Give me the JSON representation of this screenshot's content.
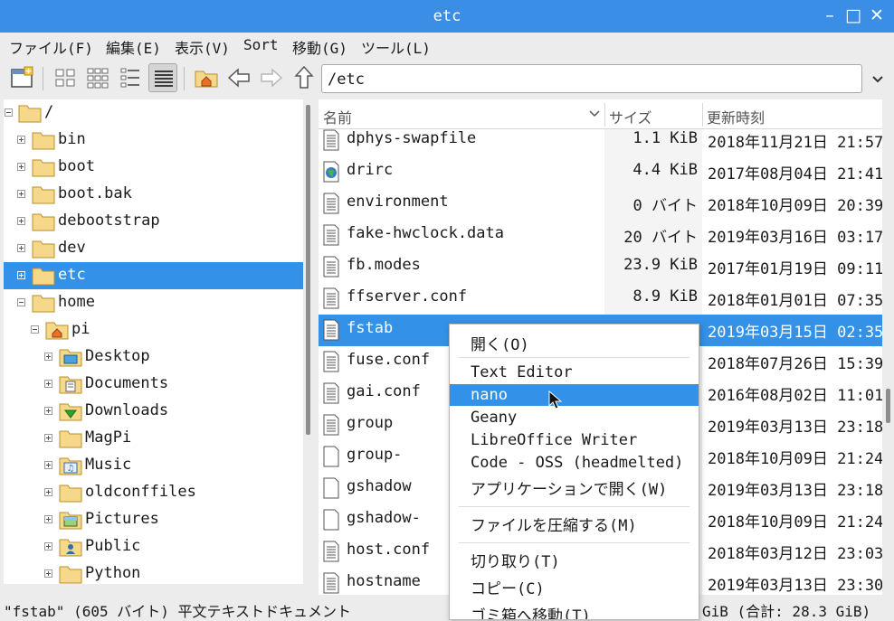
{
  "window": {
    "title": "etc",
    "minimize_label": "–",
    "maximize_label": "□",
    "close_label": "✕"
  },
  "menubar": {
    "items": [
      "ファイル(F)",
      "編集(E)",
      "表示(V)",
      "Sort",
      "移動(G)",
      "ツール(L)"
    ]
  },
  "toolbar": {
    "icons": [
      "new-window-icon",
      "icon-view-icon",
      "thumbnail-view-icon",
      "compact-view-icon",
      "detailed-list-view-icon",
      "home-icon",
      "back-arrow-icon",
      "forward-arrow-icon",
      "up-arrow-icon"
    ],
    "address": "/etc"
  },
  "tree": {
    "items": [
      {
        "label": "/",
        "depth": 0,
        "expander": "minus",
        "icon": "folder"
      },
      {
        "label": "bin",
        "depth": 1,
        "expander": "plus",
        "icon": "folder"
      },
      {
        "label": "boot",
        "depth": 1,
        "expander": "plus",
        "icon": "folder"
      },
      {
        "label": "boot.bak",
        "depth": 1,
        "expander": "plus",
        "icon": "folder"
      },
      {
        "label": "debootstrap",
        "depth": 1,
        "expander": "plus",
        "icon": "folder"
      },
      {
        "label": "dev",
        "depth": 1,
        "expander": "plus",
        "icon": "folder"
      },
      {
        "label": "etc",
        "depth": 1,
        "expander": "plus",
        "icon": "folder",
        "selected": true
      },
      {
        "label": "home",
        "depth": 1,
        "expander": "minus",
        "icon": "folder"
      },
      {
        "label": "pi",
        "depth": 2,
        "expander": "minus",
        "icon": "home-folder"
      },
      {
        "label": "Desktop",
        "depth": 3,
        "expander": "plus",
        "icon": "desktop-folder"
      },
      {
        "label": "Documents",
        "depth": 3,
        "expander": "plus",
        "icon": "documents-folder"
      },
      {
        "label": "Downloads",
        "depth": 3,
        "expander": "plus",
        "icon": "downloads-folder"
      },
      {
        "label": "MagPi",
        "depth": 3,
        "expander": "plus",
        "icon": "folder"
      },
      {
        "label": "Music",
        "depth": 3,
        "expander": "plus",
        "icon": "music-folder"
      },
      {
        "label": "oldconffiles",
        "depth": 3,
        "expander": "plus",
        "icon": "folder"
      },
      {
        "label": "Pictures",
        "depth": 3,
        "expander": "plus",
        "icon": "pictures-folder"
      },
      {
        "label": "Public",
        "depth": 3,
        "expander": "plus",
        "icon": "public-folder"
      },
      {
        "label": "Python",
        "depth": 3,
        "expander": "plus",
        "icon": "folder"
      }
    ]
  },
  "filelist": {
    "columns": {
      "name": "名前",
      "size": "サイズ",
      "modified": "更新時刻"
    },
    "rows": [
      {
        "name": "dphys-swapfile",
        "size": "1.1 KiB",
        "modified": "2018年11月21日 21:57",
        "icon": "text-file"
      },
      {
        "name": "drirc",
        "size": "4.4 KiB",
        "modified": "2017年08月04日 21:41",
        "icon": "xml-file"
      },
      {
        "name": "environment",
        "size": "0 バイト",
        "modified": "2018年10月09日 20:39",
        "icon": "text-file"
      },
      {
        "name": "fake-hwclock.data",
        "size": "20 バイト",
        "modified": "2019年03月16日 03:17",
        "icon": "text-file"
      },
      {
        "name": "fb.modes",
        "size": "23.9 KiB",
        "modified": "2017年01月19日 09:11",
        "icon": "text-file"
      },
      {
        "name": "ffserver.conf",
        "size": "8.9 KiB",
        "modified": "2018年01月01日 07:35",
        "icon": "text-file"
      },
      {
        "name": "fstab",
        "size": "",
        "modified": "2019年03月15日 02:35",
        "icon": "text-file",
        "selected": true
      },
      {
        "name": "fuse.conf",
        "size": "",
        "modified": "2018年07月26日 15:39",
        "icon": "text-file"
      },
      {
        "name": "gai.conf",
        "size": "",
        "modified": "2016年08月02日 11:01",
        "icon": "text-file"
      },
      {
        "name": "group",
        "size": "",
        "modified": "2019年03月13日 23:18",
        "icon": "text-file"
      },
      {
        "name": "group-",
        "size": "",
        "modified": "2018年10月09日 21:24",
        "icon": "blank-file"
      },
      {
        "name": "gshadow",
        "size": "",
        "modified": "2019年03月13日 23:18",
        "icon": "blank-file"
      },
      {
        "name": "gshadow-",
        "size": "",
        "modified": "2018年10月09日 21:24",
        "icon": "blank-file"
      },
      {
        "name": "host.conf",
        "size": "",
        "modified": "2018年03月12日 23:03",
        "icon": "text-file"
      },
      {
        "name": "hostname",
        "size": "",
        "modified": "2019年03月13日 23:30",
        "icon": "text-file"
      }
    ]
  },
  "context_menu": {
    "items": [
      {
        "label": "開く(O)",
        "type": "item"
      },
      {
        "type": "separator"
      },
      {
        "label": "Text Editor",
        "type": "item"
      },
      {
        "label": "nano",
        "type": "item",
        "highlighted": true
      },
      {
        "label": "Geany",
        "type": "item"
      },
      {
        "label": "LibreOffice Writer",
        "type": "item"
      },
      {
        "label": "Code - OSS (headmelted)",
        "type": "item"
      },
      {
        "label": "アプリケーションで開く(W)",
        "type": "item"
      },
      {
        "type": "separator"
      },
      {
        "label": "ファイルを圧縮する(M)",
        "type": "item"
      },
      {
        "type": "separator"
      },
      {
        "label": "切り取り(T)",
        "type": "item"
      },
      {
        "label": "コピー(C)",
        "type": "item"
      },
      {
        "label": "ゴミ箱へ移動(T)",
        "type": "item"
      }
    ]
  },
  "status": {
    "left": "\"fstab\" (605 バイト) 平文テキストドキュメント",
    "right": "GiB (合計: 28.3 GiB)"
  },
  "colors": {
    "titlebar": "#3a8ee6",
    "selection": "#3391e8",
    "folder": "#f5d88a"
  }
}
